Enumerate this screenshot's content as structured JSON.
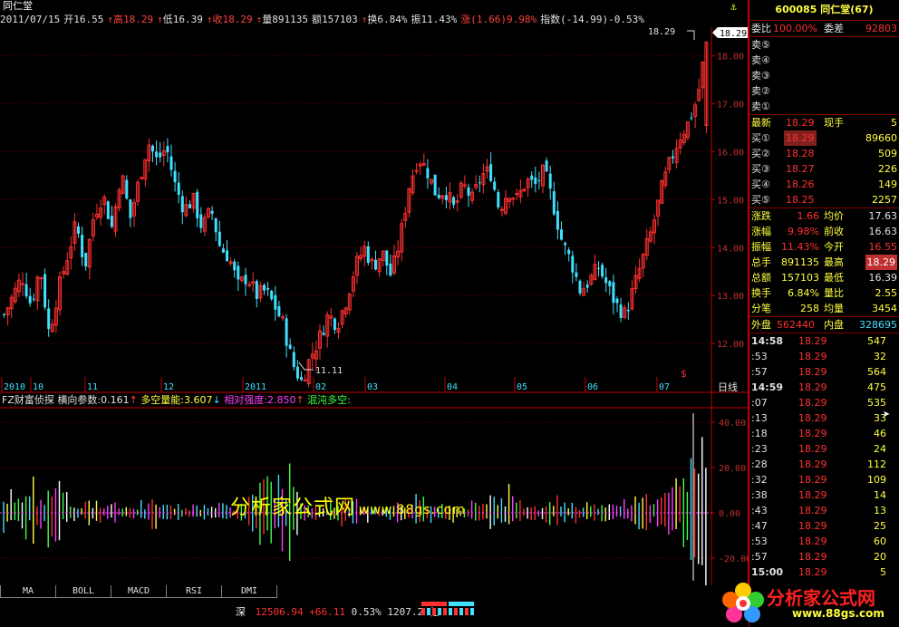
{
  "window": {
    "stock_name_title": "同仁堂",
    "top_right_icon": "anchor-icon"
  },
  "quote_bar": {
    "date": "2011/07/15",
    "open_label": "开",
    "open": "16.55",
    "high_label": "高",
    "high": "18.29",
    "low_label": "低",
    "low": "16.39",
    "close_label": "收",
    "close": "18.29",
    "volume_label": "量",
    "volume": "891135",
    "amount_label": "额",
    "amount": "157103",
    "turnover_label": "换",
    "turnover": "6.84%",
    "amplitude_label": "振",
    "amplitude": "11.43%",
    "change_label": "涨",
    "change": "(1.66)",
    "change_pct": "9.98%",
    "index_label": "指数",
    "index_change": "(-14.99)",
    "index_pct": "-0.53%"
  },
  "main_chart": {
    "price_ticks": [
      "18.00",
      "17.00",
      "16.00",
      "15.00",
      "14.00",
      "13.00",
      "12.00"
    ],
    "current_price_tag": "18.29",
    "high_mark": "18.29",
    "low_mark": "11.11",
    "time_labels": [
      "2010",
      "10",
      "11",
      "12",
      "2011",
      "02",
      "03",
      "04",
      "05",
      "06",
      "07"
    ],
    "period_label": "日线",
    "up_color": "#ff3030",
    "down_color": "#40e0ff"
  },
  "chart_data": {
    "type": "candlestick",
    "title": "同仁堂",
    "period": "daily",
    "ylim": [
      11.0,
      18.6
    ],
    "ytick_labels": [
      "12.00",
      "13.00",
      "14.00",
      "15.00",
      "16.00",
      "17.00",
      "18.00"
    ],
    "x_labels": [
      "2010",
      "10",
      "11",
      "12",
      "2011",
      "02",
      "03",
      "04",
      "05",
      "06",
      "07"
    ],
    "close_path": [
      12.6,
      13.0,
      13.4,
      12.8,
      13.6,
      12.2,
      13.1,
      13.8,
      14.5,
      13.6,
      14.7,
      15.1,
      14.4,
      15.6,
      14.6,
      15.4,
      16.2,
      15.8,
      16.1,
      15.3,
      14.8,
      15.0,
      14.4,
      14.8,
      14.0,
      13.8,
      13.2,
      13.4,
      13.0,
      13.1,
      12.8,
      12.4,
      11.6,
      11.2,
      11.7,
      12.1,
      12.6,
      12.4,
      12.9,
      13.6,
      14.0,
      13.6,
      13.9,
      13.4,
      14.2,
      15.3,
      15.9,
      15.6,
      15.1,
      15.2,
      14.8,
      15.3,
      15.0,
      15.5,
      15.6,
      14.8,
      15.2,
      15.0,
      15.4,
      15.3,
      15.6,
      14.9,
      14.1,
      13.7,
      13.1,
      13.3,
      13.6,
      13.2,
      12.8,
      12.6,
      13.2,
      13.8,
      14.4,
      15.2,
      15.8,
      16.3,
      16.6,
      17.1,
      18.29
    ],
    "final_bar": {
      "date": "2011/07/15",
      "open": 16.55,
      "high": 18.29,
      "low": 16.39,
      "close": 18.29
    },
    "low_point": 11.11,
    "high_point": 18.29,
    "indicator": {
      "name": "FZ财富侦探",
      "ytick_labels": [
        "40.00",
        "20.00",
        "0.00",
        "-20.00"
      ],
      "ylim": [
        -32,
        46
      ],
      "values": {
        "横向参数": 0.161,
        "多空量能": 3.607,
        "相对强度": 2.85
      }
    }
  },
  "indicator_panel": {
    "name": "FZ财富侦探",
    "p1_label": "横向参数:",
    "p1": "0.161",
    "p1_arrow": "↑",
    "p2_label": "多空量能:",
    "p2": "3.607",
    "p2_arrow": "↓",
    "p3_label": "相对强度:",
    "p3": "2.850",
    "p3_arrow": "↑",
    "p4_label": "混沌多空:",
    "y_ticks": [
      "40.00",
      "20.00",
      "0.00",
      "-20.00"
    ]
  },
  "watermark": {
    "text": "分析家公式网",
    "url": "www.88gs.com"
  },
  "right_panel": {
    "code": "600085",
    "name": "同仁堂(67)",
    "ratio_label": "委比",
    "ratio": "100.00%",
    "diff_label": "委差",
    "diff": "92803",
    "asks": [
      {
        "label": "卖⑤",
        "price": "",
        "vol": ""
      },
      {
        "label": "卖④",
        "price": "",
        "vol": ""
      },
      {
        "label": "卖③",
        "price": "",
        "vol": ""
      },
      {
        "label": "卖②",
        "price": "",
        "vol": ""
      },
      {
        "label": "卖①",
        "price": "",
        "vol": ""
      }
    ],
    "last_label": "最新",
    "last": "18.29",
    "now_vol_label": "现手",
    "now_vol": "5",
    "bids": [
      {
        "label": "买①",
        "price": "18.29",
        "vol": "89660"
      },
      {
        "label": "买②",
        "price": "18.28",
        "vol": "509"
      },
      {
        "label": "买③",
        "price": "18.27",
        "vol": "226"
      },
      {
        "label": "买④",
        "price": "18.26",
        "vol": "149"
      },
      {
        "label": "买⑤",
        "price": "18.25",
        "vol": "2257"
      }
    ],
    "stats": [
      {
        "l1": "涨跌",
        "v1": "1.66",
        "l2": "均价",
        "v2": "17.63"
      },
      {
        "l1": "涨幅",
        "v1": "9.98%",
        "l2": "前收",
        "v2": "16.63"
      },
      {
        "l1": "振幅",
        "v1": "11.43%",
        "l2": "今开",
        "v2": "16.55"
      },
      {
        "l1": "总手",
        "v1": "891135",
        "l2": "最高",
        "v2": "18.29"
      },
      {
        "l1": "总额",
        "v1": "157103",
        "l2": "最低",
        "v2": "16.39"
      },
      {
        "l1": "换手",
        "v1": "6.84%",
        "l2": "量比",
        "v2": "2.55"
      },
      {
        "l1": "分笔",
        "v1": "258",
        "l2": "均量",
        "v2": "3454"
      }
    ],
    "outer_label": "外盘",
    "outer": "562440",
    "inner_label": "内盘",
    "inner": "328695",
    "ticks": [
      {
        "t": "14:58",
        "p": "18.29",
        "v": "547"
      },
      {
        "t": ":53",
        "p": "18.29",
        "v": "32"
      },
      {
        "t": ":57",
        "p": "18.29",
        "v": "564"
      },
      {
        "t": "14:59",
        "p": "18.29",
        "v": "475"
      },
      {
        "t": ":07",
        "p": "18.29",
        "v": "535"
      },
      {
        "t": ":13",
        "p": "18.29",
        "v": "33"
      },
      {
        "t": ":18",
        "p": "18.29",
        "v": "46"
      },
      {
        "t": ":23",
        "p": "18.29",
        "v": "24"
      },
      {
        "t": ":28",
        "p": "18.29",
        "v": "112"
      },
      {
        "t": ":32",
        "p": "18.29",
        "v": "109"
      },
      {
        "t": ":38",
        "p": "18.29",
        "v": "14"
      },
      {
        "t": ":43",
        "p": "18.29",
        "v": "13"
      },
      {
        "t": ":47",
        "p": "18.29",
        "v": "25"
      },
      {
        "t": ":53",
        "p": "18.29",
        "v": "60"
      },
      {
        "t": ":57",
        "p": "18.29",
        "v": "20"
      },
      {
        "t": "15:00",
        "p": "18.29",
        "v": "5"
      }
    ]
  },
  "tabs": [
    "MA",
    "BOLL",
    "MACD",
    "RSI",
    "DMI"
  ],
  "status": {
    "market_label": "深",
    "index_value": "12506.94",
    "index_change": "+66.11",
    "index_pct": "0.53%",
    "turnover": "1207.29亿"
  },
  "logo": {
    "title": "分析家公式网",
    "url": "www.88gs.com"
  }
}
